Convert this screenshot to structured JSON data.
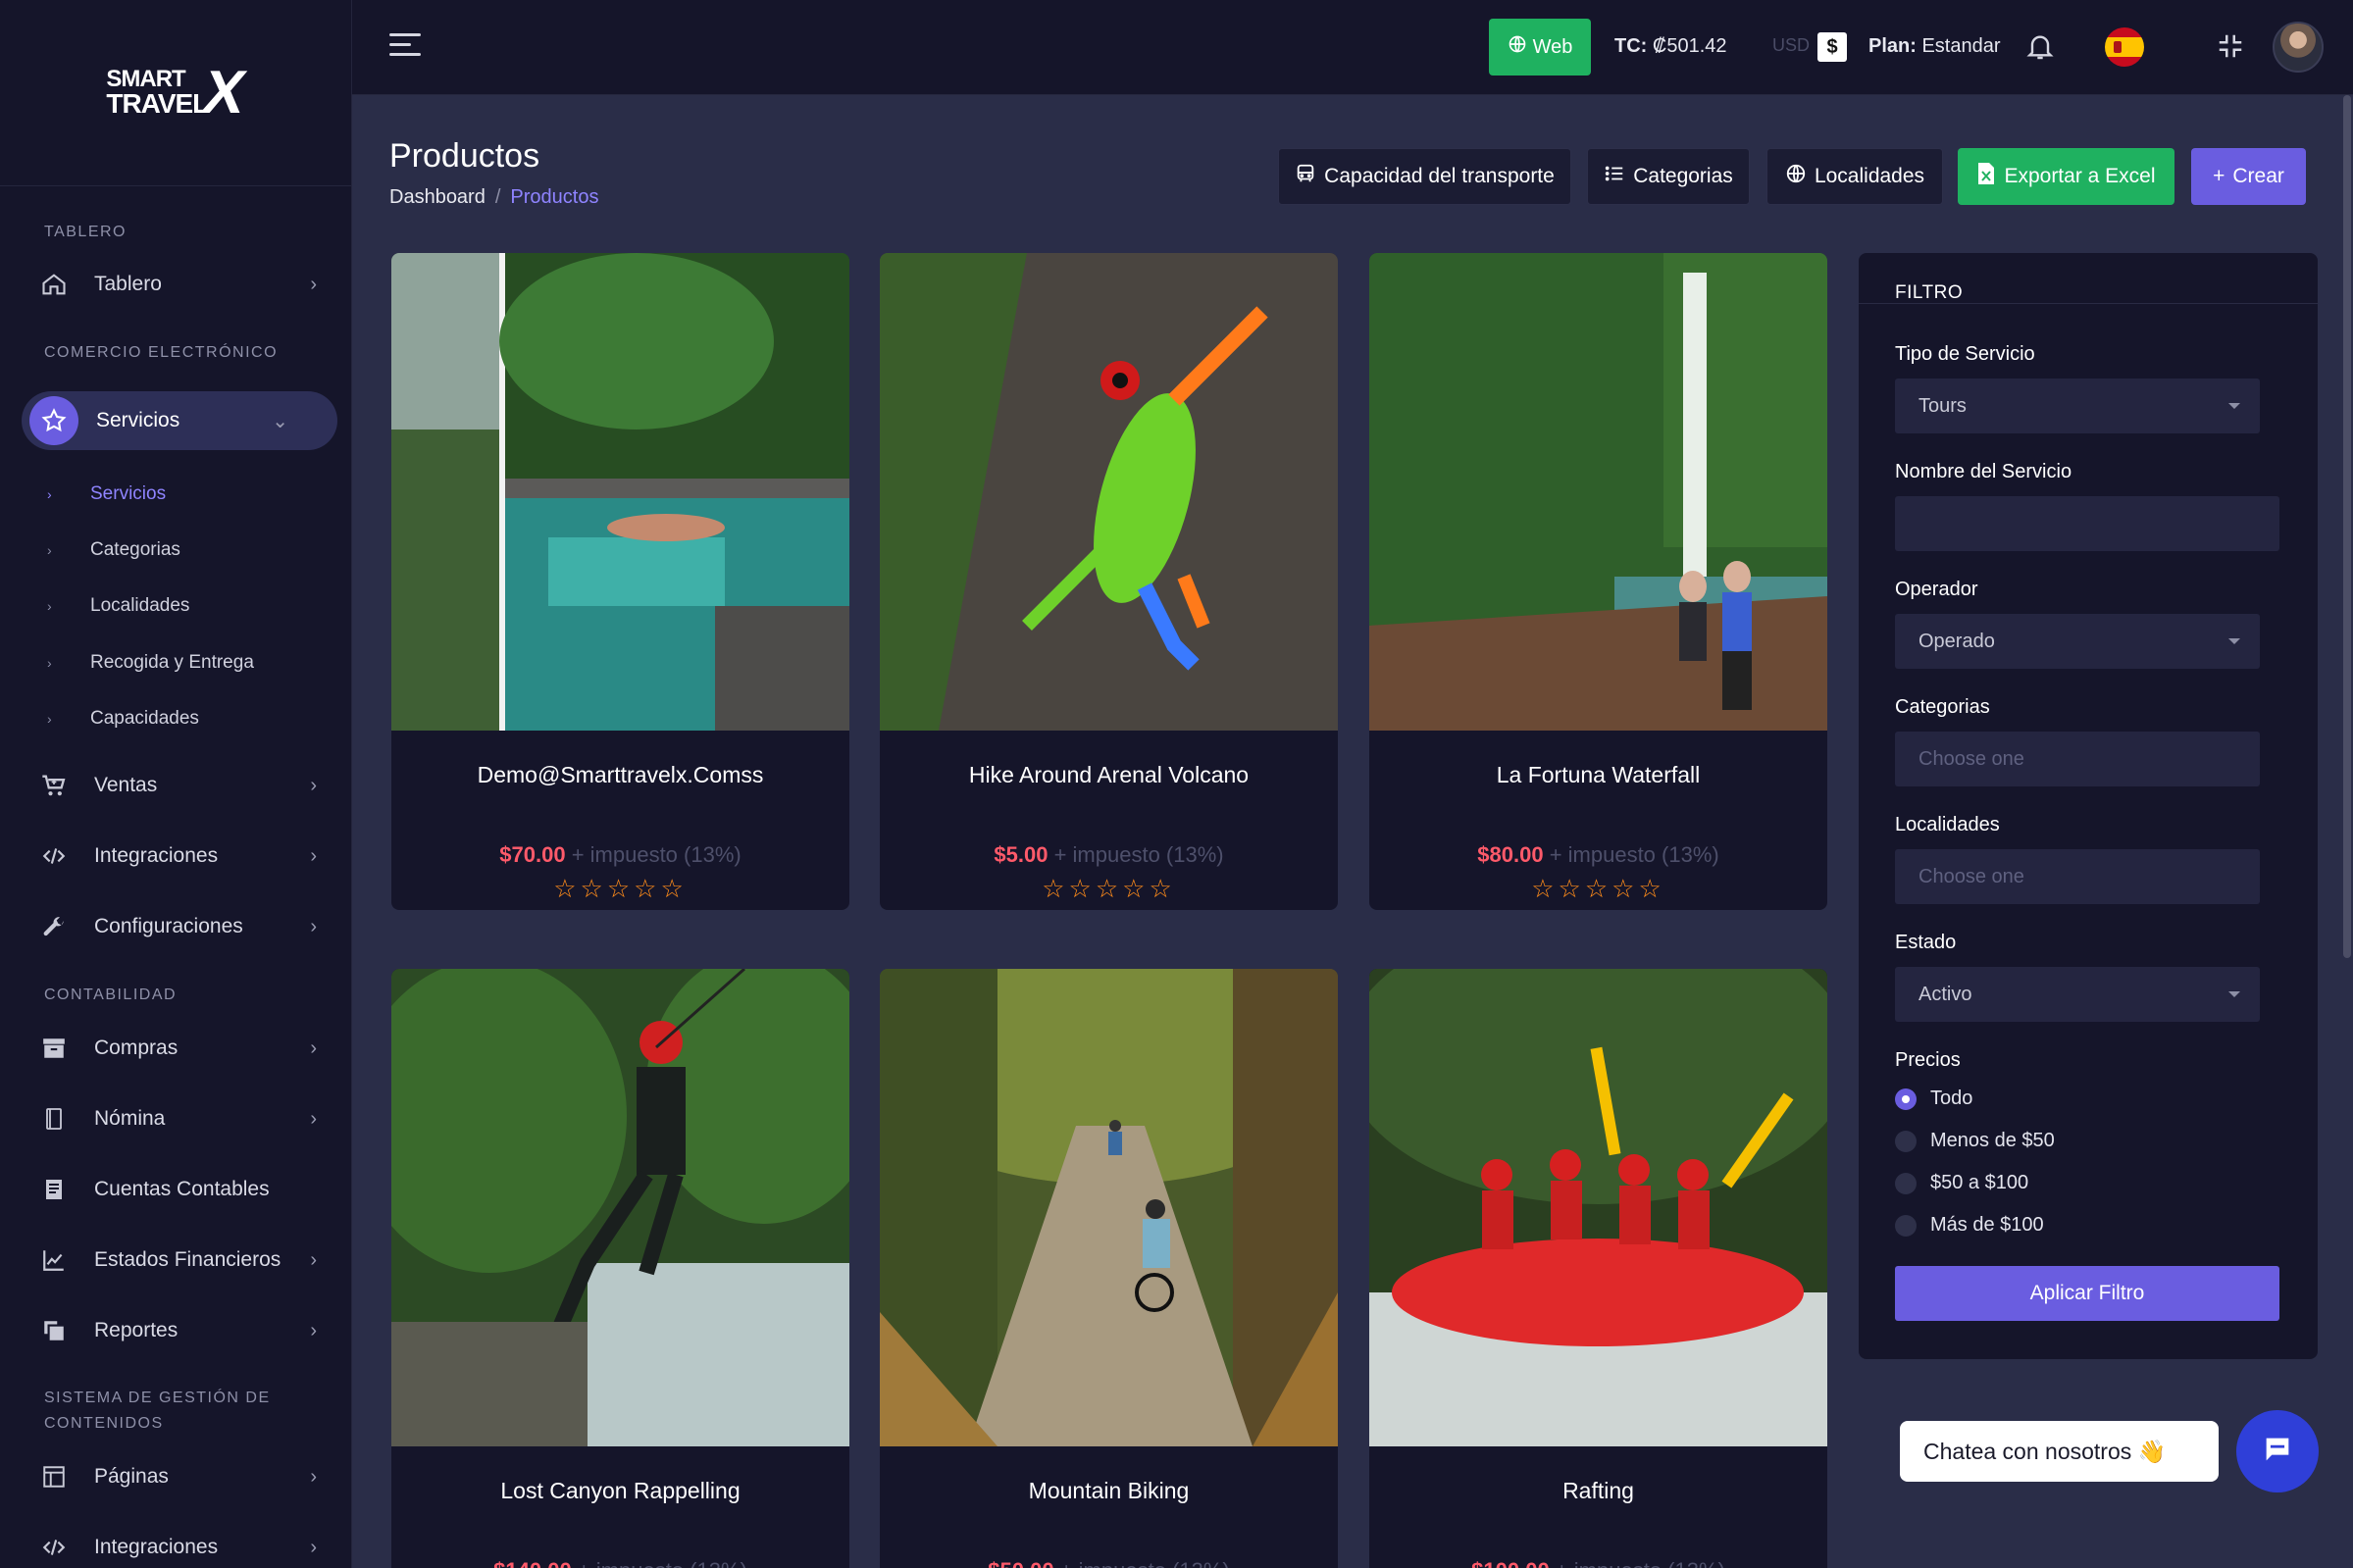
{
  "brand": {
    "line1": "SMART",
    "line2": "TRAVEL",
    "mark": "X"
  },
  "topbar": {
    "web_label": "Web",
    "tc_label": "TC:",
    "tc_value": "₡501.42",
    "currency": "USD",
    "currency_symbol": "$",
    "plan_label": "Plan:",
    "plan_value": "Estandar"
  },
  "sidebar": {
    "sec_tablero": "TABLERO",
    "tablero": "Tablero",
    "sec_comercio": "COMERCIO ELECTRÓNICO",
    "servicios": "Servicios",
    "sub": [
      "Servicios",
      "Categorias",
      "Localidades",
      "Recogida y Entrega",
      "Capacidades"
    ],
    "ventas": "Ventas",
    "integraciones": "Integraciones",
    "configuraciones": "Configuraciones",
    "sec_contabilidad": "CONTABILIDAD",
    "compras": "Compras",
    "nomina": "Nómina",
    "cuentas": "Cuentas Contables",
    "estados": "Estados Financieros",
    "reportes": "Reportes",
    "sec_sistema_1": "SISTEMA DE GESTIÓN DE",
    "sec_sistema_2": "CONTENIDOS",
    "paginas": "Páginas",
    "integraciones2": "Integraciones"
  },
  "header": {
    "title": "Productos",
    "crumb_home": "Dashboard",
    "crumb_sep": "/",
    "crumb_current": "Productos",
    "btn_capacidad": "Capacidad del transporte",
    "btn_categorias": "Categorias",
    "btn_localidades": "Localidades",
    "btn_exportar": "Exportar a Excel",
    "btn_crear": "Crear",
    "crear_plus": "+"
  },
  "products": [
    {
      "name": "Demo@Smarttravelx.Comss",
      "price": "$70.00",
      "tax": "+ impuesto (13%)",
      "stars": "☆☆☆☆☆",
      "rating": 0
    },
    {
      "name": "Hike Around Arenal Volcano",
      "price": "$5.00",
      "tax": "+ impuesto (13%)",
      "stars": "☆☆☆☆☆",
      "rating": 0
    },
    {
      "name": "La Fortuna Waterfall",
      "price": "$80.00",
      "tax": "+ impuesto (13%)",
      "stars": "☆☆☆☆☆",
      "rating": 0
    },
    {
      "name": "Lost Canyon Rappelling",
      "price": "$140.00",
      "tax": "+ impuesto (13%)",
      "stars": "☆☆☆☆☆",
      "rating": 0
    },
    {
      "name": "Mountain Biking",
      "price": "$50.00",
      "tax": "+ impuesto (13%)",
      "stars": "☆☆☆☆☆",
      "rating": 0
    },
    {
      "name": "Rafting",
      "price": "$100.00",
      "tax": "+ impuesto (13%)",
      "stars": "☆☆☆☆☆",
      "rating": 0
    }
  ],
  "filter": {
    "title": "FILTRO",
    "tipo_label": "Tipo de Servicio",
    "tipo_value": "Tours",
    "nombre_label": "Nombre del Servicio",
    "nombre_value": "",
    "operador_label": "Operador",
    "operador_value": "Operado",
    "categorias_label": "Categorias",
    "categorias_placeholder": "Choose one",
    "localidades_label": "Localidades",
    "localidades_placeholder": "Choose one",
    "estado_label": "Estado",
    "estado_value": "Activo",
    "precios_label": "Precios",
    "precios": [
      "Todo",
      "Menos de $50",
      "$50 a $100",
      "Más de $100"
    ],
    "apply": "Aplicar Filtro"
  },
  "chat": {
    "text": "Chatea con nosotros 👋"
  },
  "colors": {
    "accent": "#6a5de0",
    "green": "#1fb160",
    "price": "#ff5a6a",
    "star": "#ff8c1a",
    "bg": "#2a2d48",
    "panel": "#15152a"
  }
}
